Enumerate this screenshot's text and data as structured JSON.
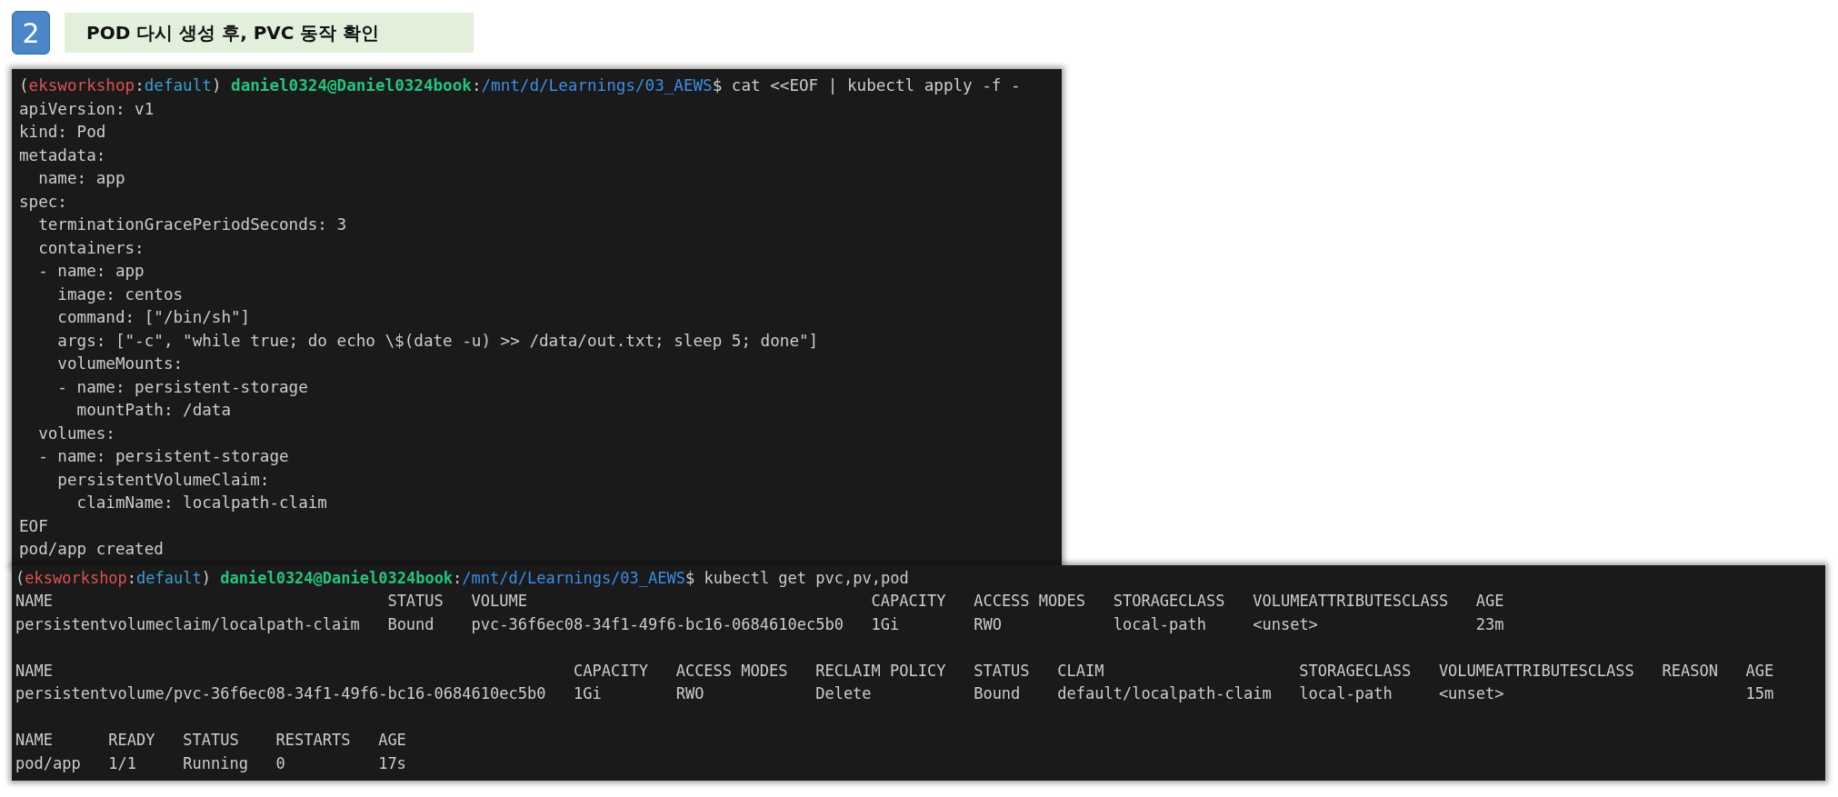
{
  "step": {
    "number": "2",
    "title": "POD 다시 생성 후, PVC 동작 확인"
  },
  "terminals": [
    {
      "prompt": [
        {
          "kind": "plain",
          "text": "("
        },
        {
          "kind": "env",
          "text": "eksworkshop"
        },
        {
          "kind": "plain",
          "text": ":"
        },
        {
          "kind": "namespace",
          "text": "default"
        },
        {
          "kind": "plain",
          "text": ") "
        },
        {
          "kind": "user",
          "text": "daniel0324@Daniel0324book"
        },
        {
          "kind": "plain",
          "text": ":"
        },
        {
          "kind": "path",
          "text": "/mnt/d/Learnings/03_AEWS"
        },
        {
          "kind": "plain",
          "text": "$ cat <<EOF | kubectl apply -f -"
        }
      ],
      "blocks": [
        {
          "kind": "lines",
          "lines": [
            "apiVersion: v1",
            "kind: Pod",
            "metadata:",
            "  name: app",
            "spec:",
            "  terminationGracePeriodSeconds: 3",
            "  containers:",
            "  - name: app",
            "    image: centos",
            "    command: [\"/bin/sh\"]",
            "    args: [\"-c\", \"while true; do echo \\$(date -u) >> /data/out.txt; sleep 5; done\"]",
            "    volumeMounts:",
            "    - name: persistent-storage",
            "      mountPath: /data",
            "  volumes:",
            "  - name: persistent-storage",
            "    persistentVolumeClaim:",
            "      claimName: localpath-claim",
            "EOF",
            "pod/app created"
          ]
        }
      ]
    },
    {
      "prompt": [
        {
          "kind": "plain",
          "text": "("
        },
        {
          "kind": "env",
          "text": "eksworkshop"
        },
        {
          "kind": "plain",
          "text": ":"
        },
        {
          "kind": "namespace",
          "text": "default"
        },
        {
          "kind": "plain",
          "text": ") "
        },
        {
          "kind": "user",
          "text": "daniel0324@Daniel0324book"
        },
        {
          "kind": "plain",
          "text": ":"
        },
        {
          "kind": "path",
          "text": "/mnt/d/Learnings/03_AEWS"
        },
        {
          "kind": "plain",
          "text": "$ kubectl get pvc,pv,pod"
        }
      ],
      "blocks": [
        {
          "kind": "table",
          "columns": [
            "NAME",
            "STATUS",
            "VOLUME",
            "CAPACITY",
            "ACCESS MODES",
            "STORAGECLASS",
            "VOLUMEATTRIBUTESCLASS",
            "AGE"
          ],
          "rows": [
            [
              "persistentvolumeclaim/localpath-claim",
              "Bound",
              "pvc-36f6ec08-34f1-49f6-bc16-0684610ec5b0",
              "1Gi",
              "RWO",
              "local-path",
              "<unset>",
              "23m"
            ]
          ]
        },
        {
          "kind": "table",
          "columns": [
            "NAME",
            "CAPACITY",
            "ACCESS MODES",
            "RECLAIM POLICY",
            "STATUS",
            "CLAIM",
            "STORAGECLASS",
            "VOLUMEATTRIBUTESCLASS",
            "REASON",
            "AGE"
          ],
          "rows": [
            [
              "persistentvolume/pvc-36f6ec08-34f1-49f6-bc16-0684610ec5b0",
              "1Gi",
              "RWO",
              "Delete",
              "Bound",
              "default/localpath-claim",
              "local-path",
              "<unset>",
              null,
              "15m"
            ]
          ]
        },
        {
          "kind": "table",
          "columns": [
            "NAME",
            "READY",
            "STATUS",
            "RESTARTS",
            "AGE"
          ],
          "rows": [
            [
              "pod/app",
              "1/1",
              "Running",
              "0",
              "17s"
            ]
          ]
        }
      ]
    }
  ]
}
